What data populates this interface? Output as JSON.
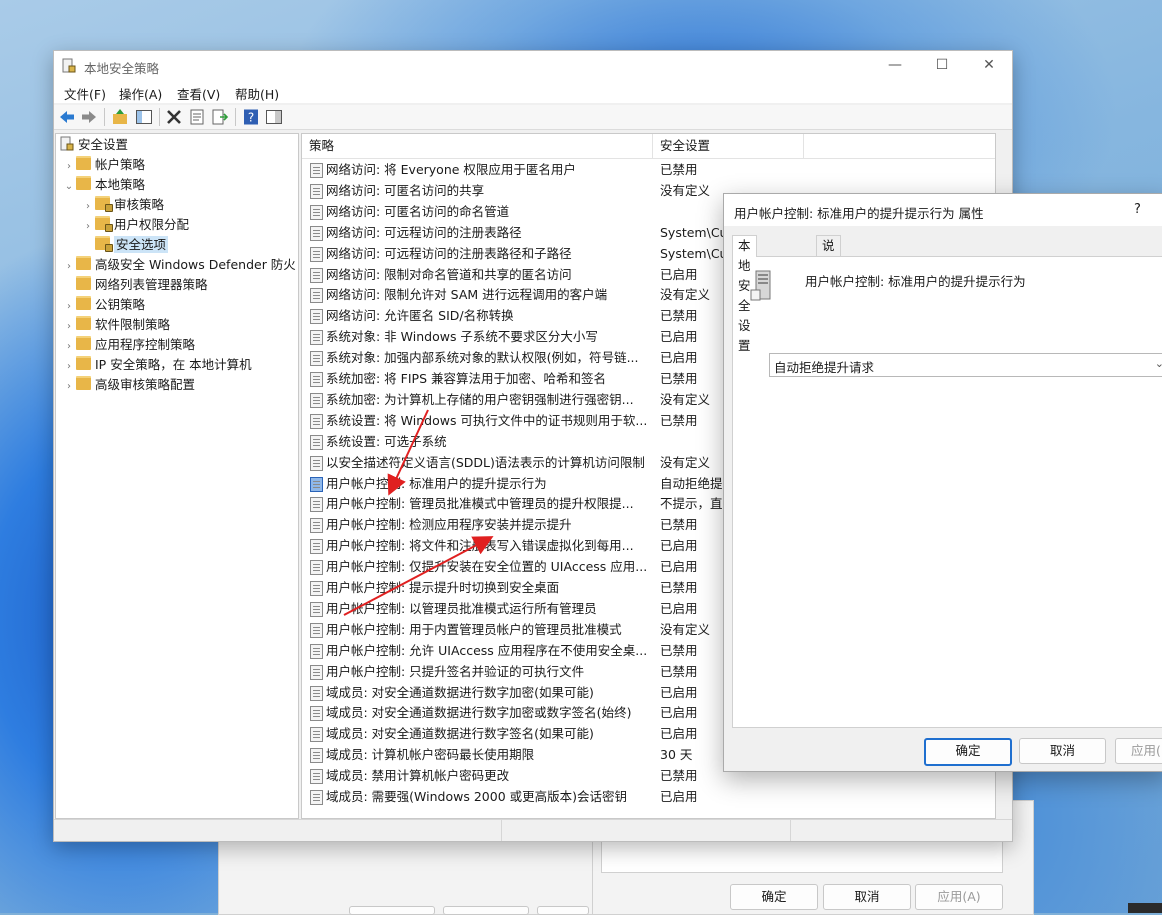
{
  "main_window": {
    "title": "本地安全策略",
    "menus": [
      "文件(F)",
      "操作(A)",
      "查看(V)",
      "帮助(H)"
    ]
  },
  "tree": {
    "root": "安全设置",
    "items": [
      {
        "label": "帐户策略",
        "level": 1,
        "chevron": "›",
        "selected": false
      },
      {
        "label": "本地策略",
        "level": 1,
        "chevron": "⌄",
        "selected": false
      },
      {
        "label": "审核策略",
        "level": 2,
        "chevron": "›",
        "selected": false
      },
      {
        "label": "用户权限分配",
        "level": 2,
        "chevron": "›",
        "selected": false
      },
      {
        "label": "安全选项",
        "level": 2,
        "chevron": "",
        "selected": true
      },
      {
        "label": "高级安全 Windows Defender 防火",
        "level": 1,
        "chevron": "›",
        "selected": false
      },
      {
        "label": "网络列表管理器策略",
        "level": 1,
        "chevron": "",
        "selected": false
      },
      {
        "label": "公钥策略",
        "level": 1,
        "chevron": "›",
        "selected": false
      },
      {
        "label": "软件限制策略",
        "level": 1,
        "chevron": "›",
        "selected": false
      },
      {
        "label": "应用程序控制策略",
        "level": 1,
        "chevron": "›",
        "selected": false
      },
      {
        "label": "IP 安全策略，在 本地计算机",
        "level": 1,
        "chevron": "›",
        "selected": false
      },
      {
        "label": "高级审核策略配置",
        "level": 1,
        "chevron": "›",
        "selected": false
      }
    ]
  },
  "list": {
    "columns": [
      "策略",
      "安全设置"
    ],
    "rows": [
      {
        "policy": "网络访问: 将 Everyone 权限应用于匿名用户",
        "setting": "已禁用"
      },
      {
        "policy": "网络访问: 可匿名访问的共享",
        "setting": "没有定义"
      },
      {
        "policy": "网络访问: 可匿名访问的命名管道",
        "setting": ""
      },
      {
        "policy": "网络访问: 可远程访问的注册表路径",
        "setting": "System\\Cur"
      },
      {
        "policy": "网络访问: 可远程访问的注册表路径和子路径",
        "setting": "System\\Cur"
      },
      {
        "policy": "网络访问: 限制对命名管道和共享的匿名访问",
        "setting": "已启用"
      },
      {
        "policy": "网络访问: 限制允许对 SAM 进行远程调用的客户端",
        "setting": "没有定义"
      },
      {
        "policy": "网络访问: 允许匿名 SID/名称转换",
        "setting": "已禁用"
      },
      {
        "policy": "系统对象: 非 Windows 子系统不要求区分大小写",
        "setting": "已启用"
      },
      {
        "policy": "系统对象: 加强内部系统对象的默认权限(例如，符号链...",
        "setting": "已启用"
      },
      {
        "policy": "系统加密: 将 FIPS 兼容算法用于加密、哈希和签名",
        "setting": "已禁用"
      },
      {
        "policy": "系统加密: 为计算机上存储的用户密钥强制进行强密钥...",
        "setting": "没有定义"
      },
      {
        "policy": "系统设置: 将 Windows 可执行文件中的证书规则用于软...",
        "setting": "已禁用"
      },
      {
        "policy": "系统设置: 可选子系统",
        "setting": ""
      },
      {
        "policy": "以安全描述符定义语言(SDDL)语法表示的计算机访问限制",
        "setting": "没有定义"
      },
      {
        "policy": "用户帐户控制: 标准用户的提升提示行为",
        "setting": "自动拒绝提",
        "selected": true
      },
      {
        "policy": "用户帐户控制: 管理员批准模式中管理员的提升权限提...",
        "setting": "不提示，直"
      },
      {
        "policy": "用户帐户控制: 检测应用程序安装并提示提升",
        "setting": "已禁用"
      },
      {
        "policy": "用户帐户控制: 将文件和注册表写入错误虚拟化到每用...",
        "setting": "已启用"
      },
      {
        "policy": "用户帐户控制: 仅提升安装在安全位置的 UIAccess 应用...",
        "setting": "已启用"
      },
      {
        "policy": "用户帐户控制: 提示提升时切换到安全桌面",
        "setting": "已禁用"
      },
      {
        "policy": "用户帐户控制: 以管理员批准模式运行所有管理员",
        "setting": "已启用"
      },
      {
        "policy": "用户帐户控制: 用于内置管理员帐户的管理员批准模式",
        "setting": "没有定义"
      },
      {
        "policy": "用户帐户控制: 允许 UIAccess 应用程序在不使用安全桌...",
        "setting": "已禁用"
      },
      {
        "policy": "用户帐户控制: 只提升签名并验证的可执行文件",
        "setting": "已禁用"
      },
      {
        "policy": "域成员: 对安全通道数据进行数字加密(如果可能)",
        "setting": "已启用"
      },
      {
        "policy": "域成员: 对安全通道数据进行数字加密或数字签名(始终)",
        "setting": "已启用"
      },
      {
        "policy": "域成员: 对安全通道数据进行数字签名(如果可能)",
        "setting": "已启用"
      },
      {
        "policy": "域成员: 计算机帐户密码最长使用期限",
        "setting": "30 天"
      },
      {
        "policy": "域成员: 禁用计算机帐户密码更改",
        "setting": "已禁用"
      },
      {
        "policy": "域成员: 需要强(Windows 2000 或更高版本)会话密钥",
        "setting": "已启用"
      }
    ]
  },
  "dialog": {
    "title": "用户帐户控制: 标准用户的提升提示行为 属性",
    "help": "?",
    "tabs": [
      "本地安全设置",
      "说明"
    ],
    "policy_name": "用户帐户控制: 标准用户的提升提示行为",
    "selected_value": "自动拒绝提升请求",
    "buttons": {
      "ok": "确定",
      "cancel": "取消",
      "apply": "应用("
    }
  },
  "background_dialog": {
    "buttons": {
      "ok": "确定",
      "cancel": "取消",
      "apply": "应用(A)"
    }
  },
  "colors": {
    "accent": "#1f6fcf",
    "selection": "#cce4f7",
    "annotation_arrow": "#e02020"
  }
}
